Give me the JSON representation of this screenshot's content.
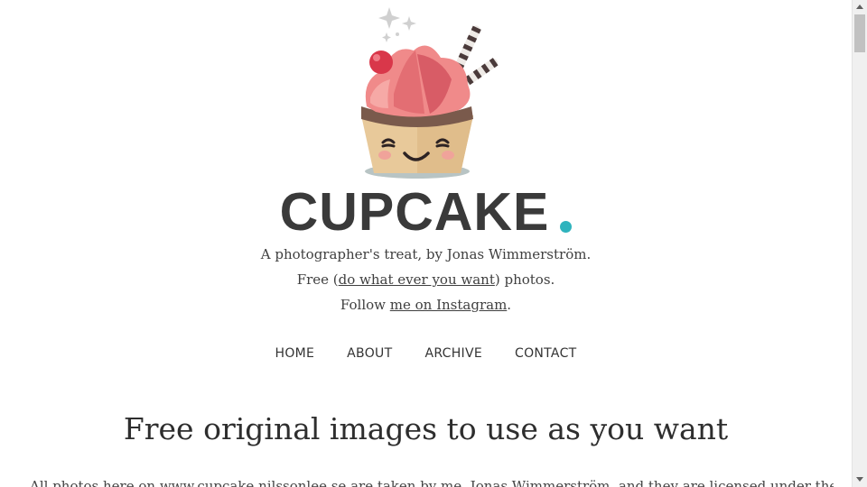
{
  "site": {
    "brand": "CUPCAKE",
    "tagline": "A photographer's treat, by Jonas Wimmerström.",
    "free_prefix": "Free (",
    "free_link": "do what ever you want",
    "free_suffix": ") photos.",
    "follow_prefix": "Follow ",
    "follow_link": "me on Instagram",
    "follow_suffix": "."
  },
  "nav": {
    "items": [
      {
        "label": "HOME"
      },
      {
        "label": "ABOUT"
      },
      {
        "label": "ARCHIVE"
      },
      {
        "label": "CONTACT"
      }
    ]
  },
  "main": {
    "heading": "Free original images to use as you want",
    "intro": "All photos here on www.cupcake.nilssonlee.se are taken by me, Jonas Wimmerström, and they are licensed under the Creative"
  },
  "colors": {
    "accent": "#2fb3bd",
    "text": "#3a3a3a"
  }
}
